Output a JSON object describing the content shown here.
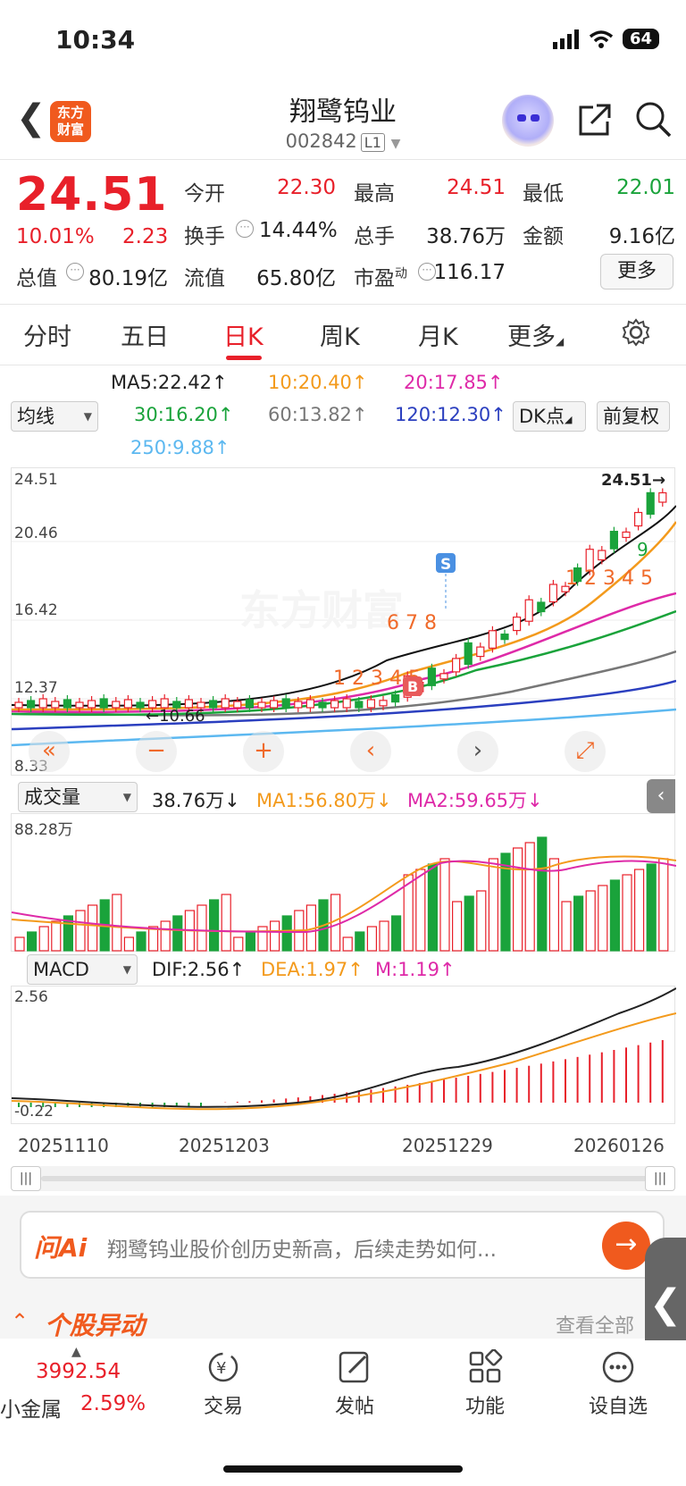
{
  "status": {
    "time": "10:34",
    "battery": "64"
  },
  "header": {
    "logo_line1": "东方",
    "logo_line2": "财富",
    "title": "翔鹭钨业",
    "code": "002842",
    "level": "L1"
  },
  "quote": {
    "price": "24.51",
    "chg_pct": "10.01%",
    "chg": "2.23",
    "open_label": "今开",
    "open": "22.30",
    "high_label": "最高",
    "high": "24.51",
    "low_label": "最低",
    "low": "22.01",
    "turnover_label": "换手",
    "turnover": "14.44%",
    "volume_label": "总手",
    "volume": "38.76万",
    "amount_label": "金额",
    "amount": "9.16亿",
    "mcap_label": "总值",
    "mcap": "80.19亿",
    "float_label": "流值",
    "float": "65.80亿",
    "pe_label": "市盈",
    "pe_sup": "动",
    "pe": "116.17",
    "more": "更多"
  },
  "tabs": [
    "分时",
    "五日",
    "日K",
    "周K",
    "月K",
    "更多"
  ],
  "ma": {
    "select": "均线",
    "ma5": "MA5:22.42",
    "ma10": "10:20.40",
    "ma20": "20:17.85",
    "ma30": "30:16.20",
    "ma60": "60:13.82",
    "ma120": "120:12.30",
    "ma250": "250:9.88",
    "dk": "DK点",
    "fq": "前复权"
  },
  "kline": {
    "y_max": "24.51",
    "y2": "20.46",
    "y3": "16.42",
    "y4": "12.37",
    "y_min": "8.33",
    "low_mark": "10.66",
    "last_label": "24.51",
    "s_mark": "S",
    "b_mark": "B"
  },
  "volume": {
    "select": "成交量",
    "value": "38.76万",
    "ma1": "MA1:56.80万",
    "ma2": "MA2:59.65万",
    "max": "88.28万"
  },
  "macd": {
    "select": "MACD",
    "dif": "DIF:2.56",
    "dea": "DEA:1.97",
    "m": "M:1.19",
    "top": "2.56",
    "bottom": "-0.22"
  },
  "dates": [
    "20251110",
    "20251203",
    "20251229",
    "20260126"
  ],
  "ai": {
    "brand": "问Ai",
    "prompt": "翔鹭钨业股价创历史新高，后续走势如何..."
  },
  "news": {
    "title": "个股异动",
    "view_all": "查看全部"
  },
  "bottom": {
    "index_value": "3992.54",
    "index_name": "小金属",
    "index_pct": "2.59%",
    "trade": "交易",
    "post": "发帖",
    "func": "功能",
    "watch": "设自选"
  },
  "chart_data": {
    "type": "candlestick",
    "symbol": "002842",
    "last_close": 24.51,
    "ylim": [
      8.33,
      24.51
    ],
    "ma_values": {
      "MA5": 22.42,
      "MA10": 20.4,
      "MA20": 17.85,
      "MA30": 16.2,
      "MA60": 13.82,
      "MA120": 12.3,
      "MA250": 9.88
    },
    "volume_last": "38.76万",
    "volume_max": "88.28万",
    "macd": {
      "DIF": 2.56,
      "DEA": 1.97,
      "M": 1.19
    },
    "x_ticks": [
      "20251110",
      "20251203",
      "20251229",
      "20260126"
    ]
  }
}
